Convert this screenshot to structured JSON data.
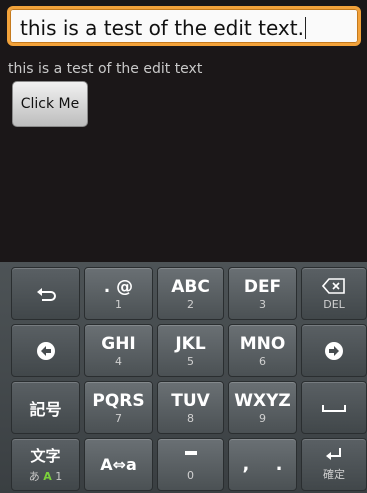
{
  "edit": {
    "value": "this is a test of the edit text."
  },
  "echo": {
    "text": "this is a test of the edit text"
  },
  "button": {
    "label": "Click Me"
  },
  "keyboard": {
    "k12": {
      "main": ". @",
      "sub": "1"
    },
    "k13": {
      "main": "ABC",
      "sub": "2"
    },
    "k14": {
      "main": "DEF",
      "sub": "3"
    },
    "k15": {
      "sub": "DEL"
    },
    "k22": {
      "main": "GHI",
      "sub": "4"
    },
    "k23": {
      "main": "JKL",
      "sub": "5"
    },
    "k24": {
      "main": "MNO",
      "sub": "6"
    },
    "k31": {
      "main": "記号"
    },
    "k32": {
      "main": "PQRS",
      "sub": "7"
    },
    "k33": {
      "main": "TUV",
      "sub": "8"
    },
    "k34": {
      "main": "WXYZ",
      "sub": "9"
    },
    "k41": {
      "main": "文字",
      "sub_a": "あ",
      "sub_b": "A",
      "sub_c": "1"
    },
    "k42": {
      "main": "A⇔a"
    },
    "k43": {
      "sub": "0"
    },
    "k44": {
      "main": ", ."
    },
    "k45": {
      "sub": "確定"
    }
  },
  "icons": [
    "undo-icon",
    "backspace-icon",
    "arrow-left-icon",
    "arrow-right-icon",
    "space-icon",
    "dash-icon",
    "enter-icon"
  ],
  "colors": {
    "edit_border": "#f3a23a",
    "background": "#1b1718",
    "shift_highlight": "#7bd13a"
  }
}
